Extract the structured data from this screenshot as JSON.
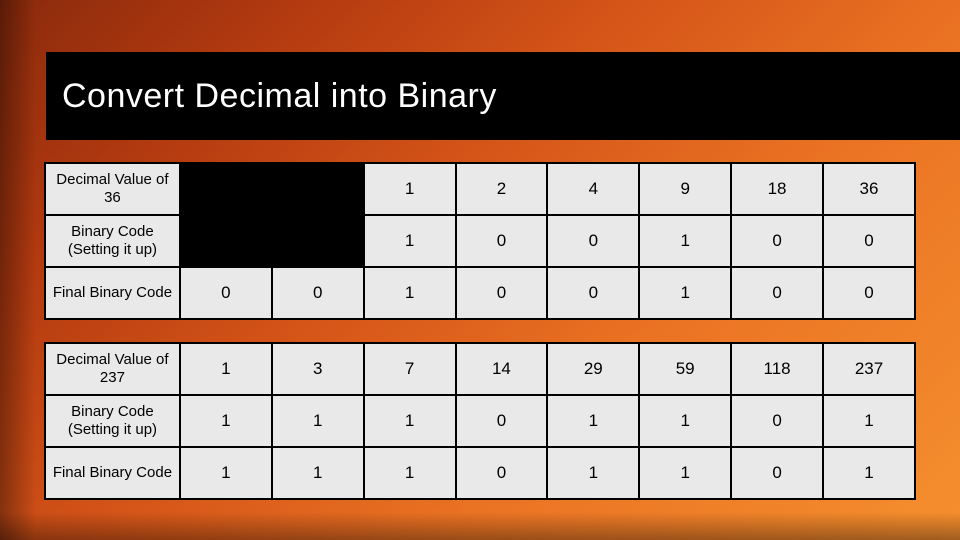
{
  "title": "Convert Decimal into Binary",
  "chart_data": [
    {
      "type": "table",
      "title": "Decimal 36 to Binary",
      "columns": 9,
      "rows": [
        {
          "header": "Decimal Value of 36",
          "cells": [
            "",
            "",
            "1",
            "2",
            "4",
            "9",
            "18",
            "36"
          ],
          "blank_leading": 2
        },
        {
          "header": "Binary Code (Setting it up)",
          "cells": [
            "",
            "",
            "1",
            "0",
            "0",
            "1",
            "0",
            "0"
          ],
          "blank_leading": 2
        },
        {
          "header": "Final Binary Code",
          "cells": [
            "0",
            "0",
            "1",
            "0",
            "0",
            "1",
            "0",
            "0"
          ],
          "blank_leading": 0
        }
      ]
    },
    {
      "type": "table",
      "title": "Decimal 237 to Binary",
      "columns": 9,
      "rows": [
        {
          "header": "Decimal Value of 237",
          "cells": [
            "1",
            "3",
            "7",
            "14",
            "29",
            "59",
            "118",
            "237"
          ],
          "blank_leading": 0
        },
        {
          "header": "Binary Code (Setting it up)",
          "cells": [
            "1",
            "1",
            "1",
            "0",
            "1",
            "1",
            "0",
            "1"
          ],
          "blank_leading": 0
        },
        {
          "header": "Final Binary Code",
          "cells": [
            "1",
            "1",
            "1",
            "0",
            "1",
            "1",
            "0",
            "1"
          ],
          "blank_leading": 0
        }
      ]
    }
  ],
  "table1": {
    "r1h": "Decimal Value of 36",
    "r1": [
      "1",
      "2",
      "4",
      "9",
      "18",
      "36"
    ],
    "r2h": "Binary Code (Setting it up)",
    "r2": [
      "1",
      "0",
      "0",
      "1",
      "0",
      "0"
    ],
    "r3h": "Final Binary Code",
    "r3": [
      "0",
      "0",
      "1",
      "0",
      "0",
      "1",
      "0",
      "0"
    ]
  },
  "table2": {
    "r1h": "Decimal Value of 237",
    "r1": [
      "1",
      "3",
      "7",
      "14",
      "29",
      "59",
      "118",
      "237"
    ],
    "r2h": "Binary Code (Setting it up)",
    "r2": [
      "1",
      "1",
      "1",
      "0",
      "1",
      "1",
      "0",
      "1"
    ],
    "r3h": "Final Binary Code",
    "r3": [
      "1",
      "1",
      "1",
      "0",
      "1",
      "1",
      "0",
      "1"
    ]
  }
}
